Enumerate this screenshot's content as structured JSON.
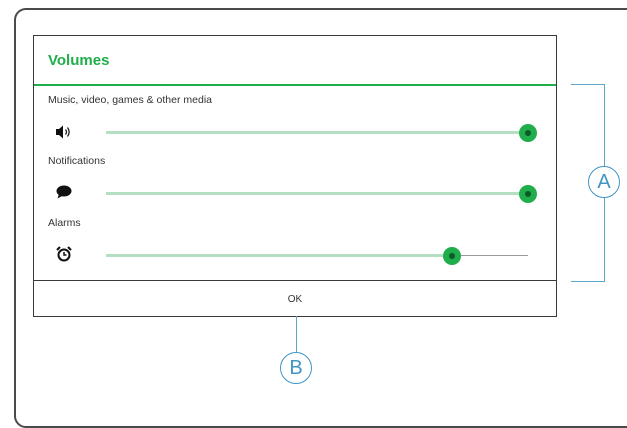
{
  "dialog": {
    "title": "Volumes",
    "ok_label": "OK"
  },
  "sliders": [
    {
      "label": "Music, video, games & other media",
      "icon": "speaker-icon",
      "level_percent": 100
    },
    {
      "label": "Notifications",
      "icon": "speech-bubble-icon",
      "level_percent": 100
    },
    {
      "label": "Alarms",
      "icon": "alarm-clock-icon",
      "level_percent": 82
    }
  ],
  "callouts": {
    "a": "A",
    "b": "B"
  },
  "colors": {
    "accent": "#1fae4b",
    "track_fill": "#b5dfc2",
    "callout": "#3f95c4"
  }
}
